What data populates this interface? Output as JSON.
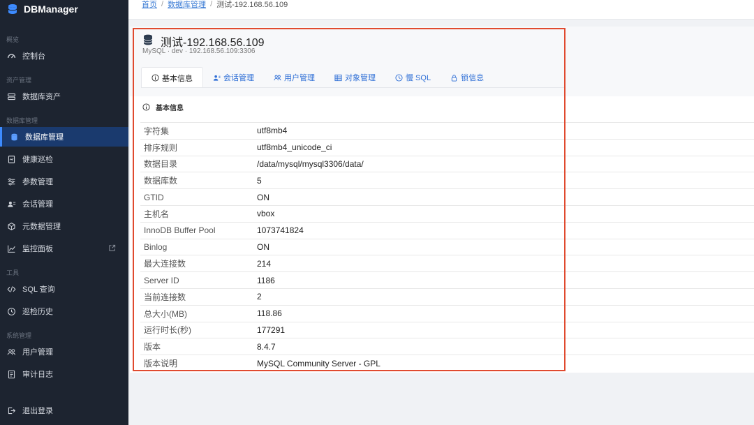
{
  "app": {
    "name": "DBManager"
  },
  "sidebar": {
    "groups": [
      "概览",
      "资产管理",
      "数据库管理",
      "工具",
      "系统管理"
    ],
    "items": [
      {
        "label": "控制台"
      },
      {
        "label": "数据库资产"
      },
      {
        "label": "数据库管理"
      },
      {
        "label": "健康巡检"
      },
      {
        "label": "参数管理"
      },
      {
        "label": "会话管理"
      },
      {
        "label": "元数据管理"
      },
      {
        "label": "监控面板"
      },
      {
        "label": "SQL 查询"
      },
      {
        "label": "巡检历史"
      },
      {
        "label": "用户管理"
      },
      {
        "label": "审计日志"
      },
      {
        "label": "退出登录"
      }
    ]
  },
  "breadcrumb": {
    "home": "首页",
    "section": "数据库管理",
    "current": "测试-192.168.56.109"
  },
  "instance": {
    "title": "测试-192.168.56.109",
    "subtitle": "MySQL · dev · 192.168.56.109:3306"
  },
  "tabs": [
    {
      "label": "基本信息"
    },
    {
      "label": "会话管理"
    },
    {
      "label": "用户管理"
    },
    {
      "label": "对象管理"
    },
    {
      "label": "慢 SQL"
    },
    {
      "label": "锁信息"
    }
  ],
  "section": {
    "title": "基本信息"
  },
  "info": [
    {
      "key": "字符集",
      "value": "utf8mb4"
    },
    {
      "key": "排序规则",
      "value": "utf8mb4_unicode_ci"
    },
    {
      "key": "数据目录",
      "value": "/data/mysql/mysql3306/data/"
    },
    {
      "key": "数据库数",
      "value": "5"
    },
    {
      "key": "GTID",
      "value": "ON"
    },
    {
      "key": "主机名",
      "value": "vbox"
    },
    {
      "key": "InnoDB Buffer Pool",
      "value": "1073741824"
    },
    {
      "key": "Binlog",
      "value": "ON"
    },
    {
      "key": "最大连接数",
      "value": "214"
    },
    {
      "key": "Server ID",
      "value": "1186"
    },
    {
      "key": "当前连接数",
      "value": "2"
    },
    {
      "key": "总大小(MB)",
      "value": "118.86"
    },
    {
      "key": "运行时长(秒)",
      "value": "177291"
    },
    {
      "key": "版本",
      "value": "8.4.7"
    },
    {
      "key": "版本说明",
      "value": "MySQL Community Server - GPL"
    }
  ],
  "colors": {
    "sidebar_bg": "#1d2430",
    "active_bg": "#1a3a6e",
    "accent": "#3d8bff",
    "highlight": "#e04a2f"
  },
  "icons": [
    "database-icon",
    "dashboard-icon",
    "server-icon",
    "health-icon",
    "sliders-icon",
    "users-icon",
    "cube-icon",
    "chart-icon",
    "external-link-icon",
    "code-icon",
    "history-icon",
    "user-group-icon",
    "document-icon",
    "logout-icon",
    "info-icon",
    "table-icon",
    "clock-icon",
    "lock-icon"
  ]
}
